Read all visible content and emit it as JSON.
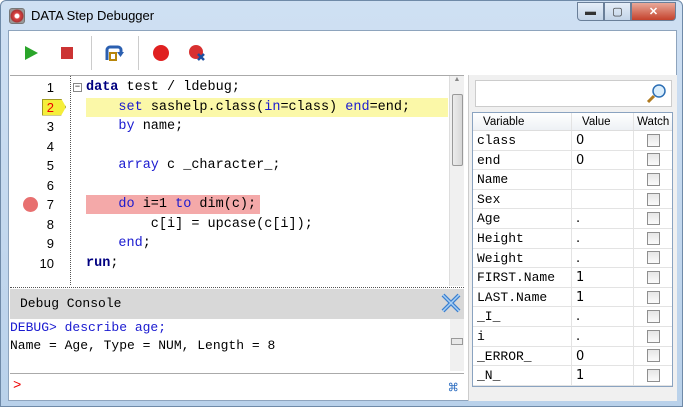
{
  "window": {
    "title": "DATA Step Debugger"
  },
  "toolbar": [
    "go",
    "stop",
    "step",
    "toggle-breakpoint",
    "clear-breakpoints"
  ],
  "editor": {
    "lines": [
      {
        "n": "1",
        "tokens": [
          [
            "kwb",
            "data"
          ],
          [
            "tx",
            " test / ldebug;"
          ]
        ]
      },
      {
        "n": "2",
        "tokens": [
          [
            "tx",
            "    "
          ],
          [
            "kw",
            "set"
          ],
          [
            "tx",
            " sashelp.class("
          ],
          [
            "kw",
            "in"
          ],
          [
            "tx",
            "=class) "
          ],
          [
            "kw",
            "end"
          ],
          [
            "tx",
            "=end;"
          ]
        ],
        "current": true
      },
      {
        "n": "3",
        "tokens": [
          [
            "tx",
            "    "
          ],
          [
            "kw",
            "by"
          ],
          [
            "tx",
            " name;"
          ]
        ]
      },
      {
        "n": "4",
        "tokens": []
      },
      {
        "n": "5",
        "tokens": [
          [
            "tx",
            "    "
          ],
          [
            "kw",
            "array"
          ],
          [
            "tx",
            " c _character_;"
          ]
        ]
      },
      {
        "n": "6",
        "tokens": []
      },
      {
        "n": "7",
        "tokens": [
          [
            "tx",
            "    "
          ],
          [
            "kw",
            "do"
          ],
          [
            "tx",
            " i=1 "
          ],
          [
            "kw",
            "to"
          ],
          [
            "tx",
            " dim(c);"
          ]
        ],
        "breakpoint": true
      },
      {
        "n": "8",
        "tokens": [
          [
            "tx",
            "        c[i] = upcase(c[i]);"
          ]
        ]
      },
      {
        "n": "9",
        "tokens": [
          [
            "tx",
            "    "
          ],
          [
            "kw",
            "end"
          ],
          [
            "tx",
            ";"
          ]
        ]
      },
      {
        "n": "10",
        "tokens": [
          [
            "kwb",
            "run"
          ],
          [
            "tx",
            ";"
          ]
        ]
      }
    ],
    "current_line_color": "#fbf8a8",
    "breakpoint_line_color": "#f4a9a9"
  },
  "console": {
    "title": "Debug Console",
    "lines": [
      {
        "text": "DEBUG> describe age;",
        "color": "#1a1ad0"
      },
      {
        "text": "Name = Age, Type = NUM, Length = 8",
        "color": "#000"
      }
    ],
    "prompt": ">"
  },
  "variables": {
    "search_value": "",
    "headers": [
      "Variable",
      "Value",
      "Watch"
    ],
    "rows": [
      [
        "class",
        "0"
      ],
      [
        "end",
        "0"
      ],
      [
        "Name",
        ""
      ],
      [
        "Sex",
        ""
      ],
      [
        "Age",
        "."
      ],
      [
        "Height",
        "."
      ],
      [
        "Weight",
        "."
      ],
      [
        "FIRST.Name",
        "1"
      ],
      [
        "LAST.Name",
        "1"
      ],
      [
        "_I_",
        "."
      ],
      [
        "i",
        "."
      ],
      [
        "_ERROR_",
        "0"
      ],
      [
        "_N_",
        "1"
      ]
    ]
  }
}
